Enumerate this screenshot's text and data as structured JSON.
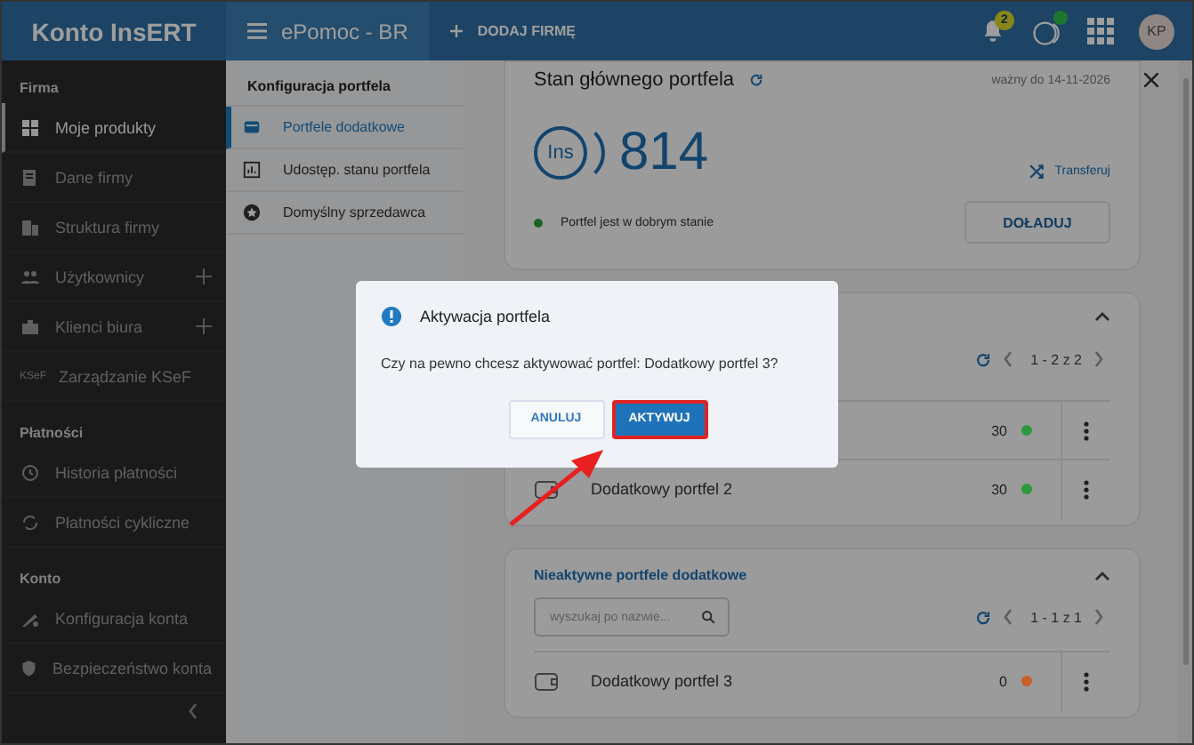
{
  "topbar": {
    "brand": "Konto InsERT",
    "company": "ePomoc - BR",
    "add_company": "DODAJ FIRMĘ",
    "notifications": "2",
    "avatar": "KP"
  },
  "sidebar": {
    "sections": [
      {
        "title": "Firma",
        "items": [
          {
            "label": "Moje produkty",
            "selected": true,
            "expandable": false
          },
          {
            "label": "Dane firmy",
            "selected": false,
            "expandable": false
          },
          {
            "label": "Struktura firmy",
            "selected": false,
            "expandable": false
          },
          {
            "label": "Użytkownicy",
            "selected": false,
            "expandable": true
          },
          {
            "label": "Klienci biura",
            "selected": false,
            "expandable": true
          },
          {
            "label": "Zarządzanie KSeF",
            "badge": "KSeF",
            "selected": false,
            "expandable": false
          }
        ]
      },
      {
        "title": "Płatności",
        "items": [
          {
            "label": "Historia płatności",
            "selected": false,
            "expandable": false
          },
          {
            "label": "Płatności cykliczne",
            "selected": false,
            "expandable": false
          }
        ]
      },
      {
        "title": "Konto",
        "items": [
          {
            "label": "Konfiguracja konta",
            "selected": false,
            "expandable": false
          },
          {
            "label": "Bezpieczeństwo konta",
            "selected": false,
            "expandable": false
          }
        ]
      }
    ]
  },
  "subnav": {
    "title": "Konfiguracja portfela",
    "items": [
      {
        "label": "Portfele dodatkowe",
        "selected": true
      },
      {
        "label": "Udostęp. stanu portfela",
        "selected": false
      },
      {
        "label": "Domyślny sprzedawca",
        "selected": false
      }
    ]
  },
  "main_wallet": {
    "title": "Stan głównego portfela",
    "valid_until": "ważny do 14-11-2026",
    "logo": "Ins",
    "balance": "814",
    "transfer": "Transferuj",
    "status": "Portfel jest w dobrym stanie",
    "top_up": "DOŁADUJ"
  },
  "active_wallets": {
    "expanded": true,
    "pagination": "1 - 2 z 2",
    "rows": [
      {
        "amount": "30",
        "color": "#2a9a3c"
      },
      {
        "name": "Dodatkowy portfel 2",
        "amount": "30",
        "color": "#2a9a3c"
      }
    ]
  },
  "inactive_wallets": {
    "title": "Nieaktywne portfele dodatkowe",
    "expanded": true,
    "search": {
      "placeholder": "wyszukaj po nazwie..."
    },
    "pagination": "1 - 1 z 1",
    "rows": [
      {
        "name": "Dodatkowy portfel 3",
        "amount": "0",
        "color": "#c8602a"
      }
    ]
  },
  "dialog": {
    "title": "Aktywacja portfela",
    "message": "Czy na pewno chcesz aktywować portfel: Dodatkowy portfel 3?",
    "buttons": [
      {
        "label": "ANULUJ",
        "kind": "secondary",
        "highlighted": false
      },
      {
        "label": "AKTYWUJ",
        "kind": "primary",
        "highlighted": true
      }
    ]
  }
}
